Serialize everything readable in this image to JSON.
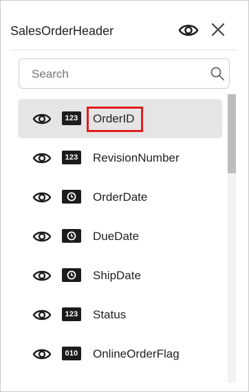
{
  "header": {
    "title": "SalesOrderHeader",
    "visibility_icon": "eye-icon",
    "close_icon": "close-icon"
  },
  "search": {
    "placeholder": "Search",
    "value": "",
    "icon": "search-icon"
  },
  "fields": [
    {
      "label": "OrderID",
      "type": "123",
      "type_icon": "number-type-icon",
      "selected": true,
      "highlighted": true
    },
    {
      "label": "RevisionNumber",
      "type": "123",
      "type_icon": "number-type-icon",
      "selected": false
    },
    {
      "label": "OrderDate",
      "type": "clock",
      "type_icon": "datetime-type-icon",
      "selected": false
    },
    {
      "label": "DueDate",
      "type": "clock",
      "type_icon": "datetime-type-icon",
      "selected": false
    },
    {
      "label": "ShipDate",
      "type": "clock",
      "type_icon": "datetime-type-icon",
      "selected": false
    },
    {
      "label": "Status",
      "type": "123",
      "type_icon": "number-type-icon",
      "selected": false
    },
    {
      "label": "OnlineOrderFlag",
      "type": "010",
      "type_icon": "boolean-type-icon",
      "selected": false
    }
  ],
  "colors": {
    "selected_row": "#e5e5e5",
    "highlight_border": "#e21b1b",
    "type_badge": "#1c1c1c"
  }
}
